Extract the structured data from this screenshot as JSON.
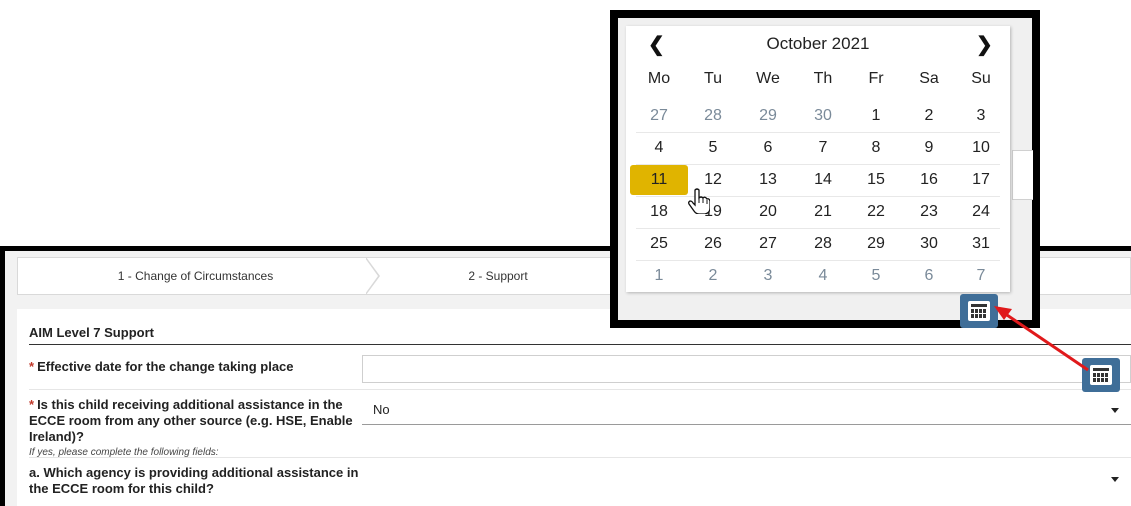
{
  "steps": [
    {
      "label": "1 - Change of Circumstances"
    },
    {
      "label": "2 - Support"
    }
  ],
  "section": {
    "title": "AIM Level 7 Support"
  },
  "questions": {
    "effective_date": {
      "required_mark": "*",
      "label": "Effective date for the change taking place",
      "value": ""
    },
    "additional_assistance": {
      "required_mark": "*",
      "label": "Is this child receiving additional assistance in the ECCE room from any other source (e.g. HSE, Enable Ireland)?",
      "help": "If yes, please complete the following fields:",
      "value": "No"
    },
    "agency": {
      "label": "a. Which agency is providing additional assistance in the ECCE room for this child?",
      "value": ""
    }
  },
  "calendar": {
    "month_title": "October 2021",
    "prev_label": "❮",
    "next_label": "❯",
    "weekdays": [
      "Mo",
      "Tu",
      "We",
      "Th",
      "Fr",
      "Sa",
      "Su"
    ],
    "weeks": [
      [
        "27",
        "28",
        "29",
        "30",
        "1",
        "2",
        "3"
      ],
      [
        "4",
        "5",
        "6",
        "7",
        "8",
        "9",
        "10"
      ],
      [
        "11",
        "12",
        "13",
        "14",
        "15",
        "16",
        "17"
      ],
      [
        "18",
        "19",
        "20",
        "21",
        "22",
        "23",
        "24"
      ],
      [
        "25",
        "26",
        "27",
        "28",
        "29",
        "30",
        "31"
      ],
      [
        "1",
        "2",
        "3",
        "4",
        "5",
        "6",
        "7"
      ]
    ],
    "selected_day": "11",
    "selected_color": "#e0b400",
    "other_month_color": "#7a8a99"
  },
  "icons": {
    "calendar_button": "calendar-icon",
    "cursor": "hand-pointer-icon"
  },
  "colors": {
    "accent_button": "#3f6e98",
    "required_mark": "#c0392b",
    "annotation_arrow": "#e0191b"
  }
}
